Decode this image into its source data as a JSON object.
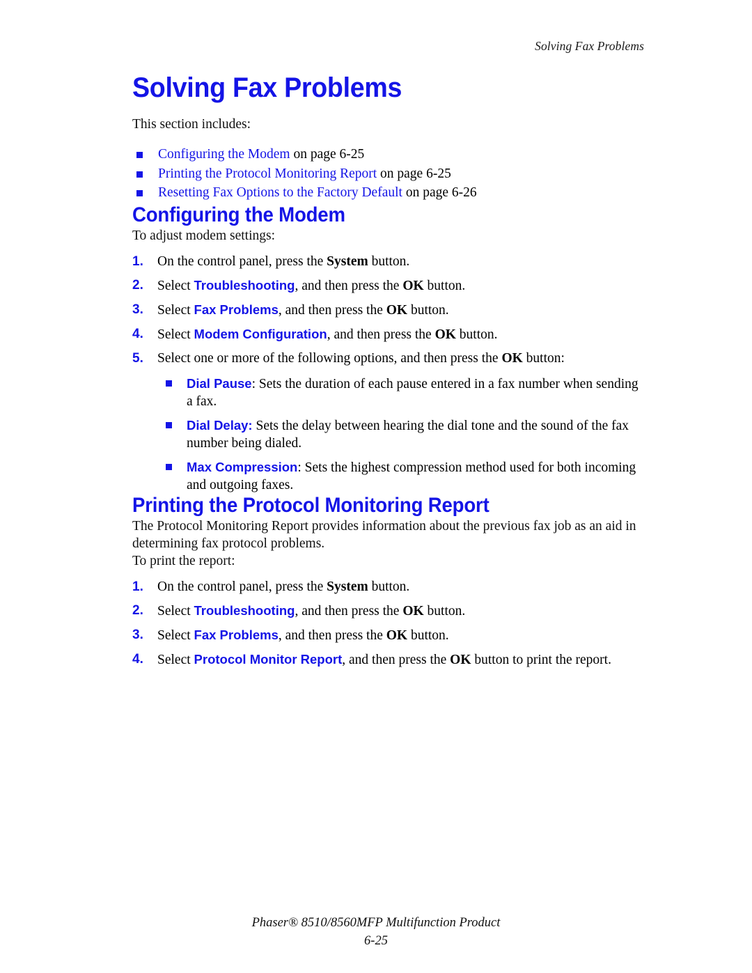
{
  "running_header": "Solving Fax Problems",
  "accent_color": "#1414e6",
  "title": "Solving Fax Problems",
  "intro": "This section includes:",
  "xrefs": [
    {
      "link": "Configuring the Modem",
      "tail": " on page 6-25"
    },
    {
      "link": "Printing the Protocol Monitoring Report",
      "tail": " on page 6-25"
    },
    {
      "link": "Resetting Fax Options to the Factory Default",
      "tail": " on page 6-26"
    }
  ],
  "modem_section": {
    "heading": "Configuring the Modem",
    "lead": "To adjust modem settings:",
    "steps": [
      {
        "num": "1.",
        "pre": "On the control panel, press the ",
        "bold": "System",
        "post": " button."
      },
      {
        "num": "2.",
        "pre": "Select ",
        "ui": "Troubleshooting",
        "mid": ", and then press the ",
        "bold": "OK",
        "post": " button."
      },
      {
        "num": "3.",
        "pre": "Select ",
        "ui": "Fax Problems",
        "mid": ", and then press the ",
        "bold": "OK",
        "post": " button."
      },
      {
        "num": "4.",
        "pre": "Select ",
        "ui": "Modem Configuration",
        "mid": ", and then press the ",
        "bold": "OK",
        "post": " button."
      },
      {
        "num": "5.",
        "pre": "Select one or more of the following options, and then press the ",
        "bold": "OK",
        "post": " button:"
      }
    ],
    "options": [
      {
        "ui": "Dial Pause",
        "sep": ": ",
        "text": "Sets the duration of each pause entered in a fax number when sending a fax."
      },
      {
        "ui": "Dial Delay:",
        "sep": " ",
        "text": "Sets the delay between hearing the dial tone and the sound of the fax number being dialed."
      },
      {
        "ui": "Max Compression",
        "sep": ": ",
        "text": "Sets the highest compression method used for both incoming and outgoing faxes."
      }
    ]
  },
  "protocol_section": {
    "heading": "Printing the Protocol Monitoring Report",
    "para": "The Protocol Monitoring Report provides information about the previous fax job as an aid in determining fax protocol problems.",
    "lead": "To print the report:",
    "steps": [
      {
        "num": "1.",
        "pre": "On the control panel, press the ",
        "bold": "System",
        "post": " button."
      },
      {
        "num": "2.",
        "pre": "Select ",
        "ui": "Troubleshooting",
        "mid": ", and then press the ",
        "bold": "OK",
        "post": " button."
      },
      {
        "num": "3.",
        "pre": "Select ",
        "ui": "Fax Problems",
        "mid": ", and then press the ",
        "bold": "OK",
        "post": " button."
      },
      {
        "num": "4.",
        "pre": "Select ",
        "ui": "Protocol Monitor Report",
        "mid": ", and then press the ",
        "bold": "OK",
        "post": " button to print the report."
      }
    ]
  },
  "footer": {
    "product": "Phaser® 8510/8560MFP Multifunction Product",
    "page": "6-25"
  }
}
